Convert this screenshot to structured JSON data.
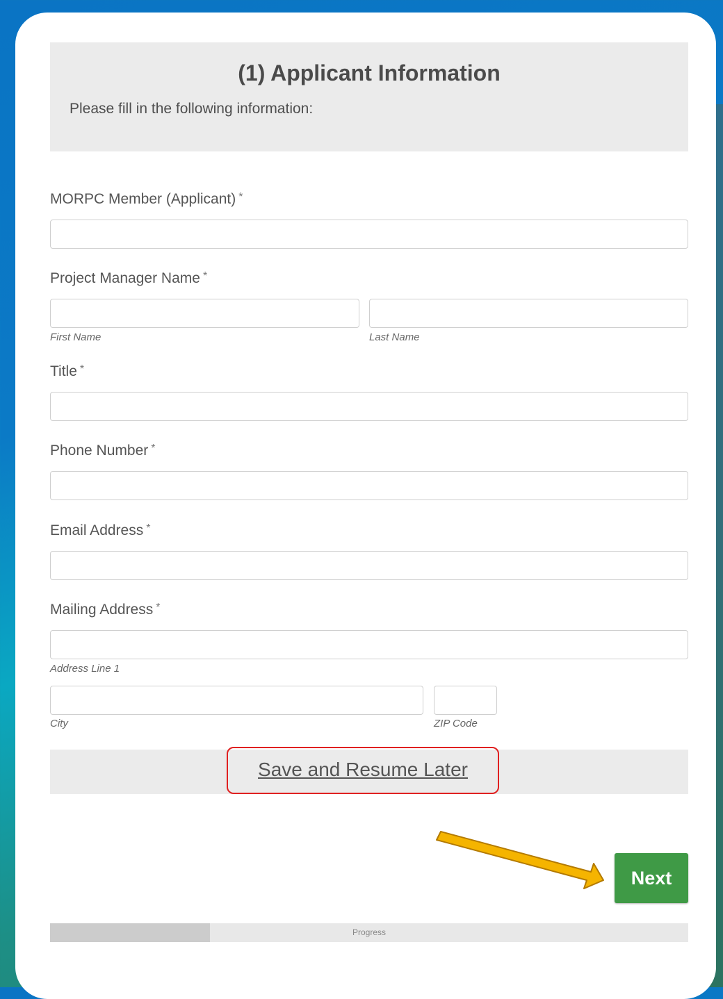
{
  "header": {
    "title": "(1) Applicant Information",
    "subtitle": "Please fill in the following information:"
  },
  "fields": {
    "member": {
      "label": "MORPC Member (Applicant)",
      "required": "*"
    },
    "manager": {
      "label": "Project Manager Name",
      "required": "*",
      "first": "First Name",
      "last": "Last Name"
    },
    "title": {
      "label": "Title",
      "required": "*"
    },
    "phone": {
      "label": "Phone Number",
      "required": "*"
    },
    "email": {
      "label": "Email Address",
      "required": "*"
    },
    "mailing": {
      "label": "Mailing Address",
      "required": "*",
      "line1": "Address Line 1",
      "city": "City",
      "zip": "ZIP Code"
    }
  },
  "actions": {
    "save_label": "Save and Resume Later",
    "next_label": "Next"
  },
  "progress": {
    "label": "Progress",
    "fraction": 0.25
  },
  "colors": {
    "next_button": "#3f9a46",
    "highlight_box": "#e02020",
    "arrow": "#f5b400"
  }
}
